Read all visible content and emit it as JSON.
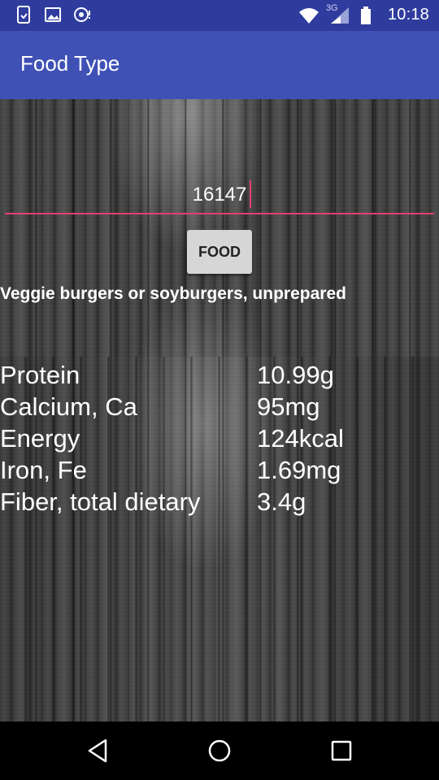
{
  "status_bar": {
    "time": "10:18",
    "network_label": "3G",
    "icons": [
      "phone-sim-icon",
      "image-icon",
      "debug-icon",
      "wifi-icon",
      "signal-icon",
      "battery-icon"
    ]
  },
  "app_bar": {
    "title": "Food Type"
  },
  "search": {
    "value": "16147"
  },
  "food_button": {
    "label": "FOOD"
  },
  "food_name": "Veggie burgers or soyburgers, unprepared",
  "nutrients": [
    {
      "name": "Protein",
      "value": "10.99g"
    },
    {
      "name": "Calcium, Ca",
      "value": "95mg"
    },
    {
      "name": "Energy",
      "value": "124kcal"
    },
    {
      "name": "Iron, Fe",
      "value": "1.69mg"
    },
    {
      "name": "Fiber, total dietary",
      "value": "3.4g"
    }
  ],
  "colors": {
    "status_bar": "#2f3c9d",
    "app_bar": "#3f51b5",
    "accent": "#e0406e"
  },
  "nav_bar": {
    "icons": [
      "back-icon",
      "home-icon",
      "recents-icon"
    ]
  }
}
